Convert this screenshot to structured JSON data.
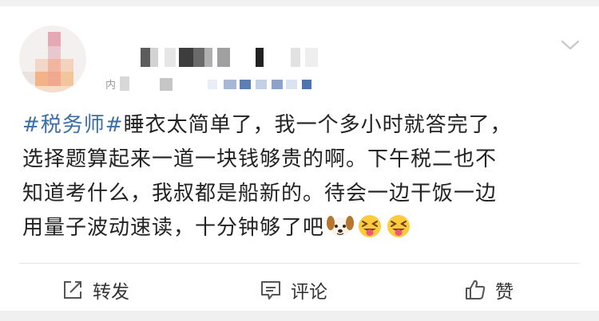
{
  "post": {
    "hashtag": "#税务师#",
    "text_line1_rest": "睡衣太简单了，我一个多小时就答完了，",
    "text_line2": "选择题算起来一道一块钱够贵的啊。下午税二也不",
    "text_line3": "知道考什么，我叔都是船新的。待会一边干饭一边",
    "text_line4": "用量子波动速读，十分钟够了吧",
    "emojis": [
      "dog-face-icon",
      "squinting-tongue-face-icon",
      "squinting-tongue-face-icon"
    ]
  },
  "meta": {
    "prefix": "内"
  },
  "actions": {
    "repost_label": "转发",
    "comment_label": "评论",
    "like_label": "赞"
  },
  "colors": {
    "hashtag": "#3c6ea8",
    "text": "#222222",
    "background": "#f2f2f2"
  }
}
